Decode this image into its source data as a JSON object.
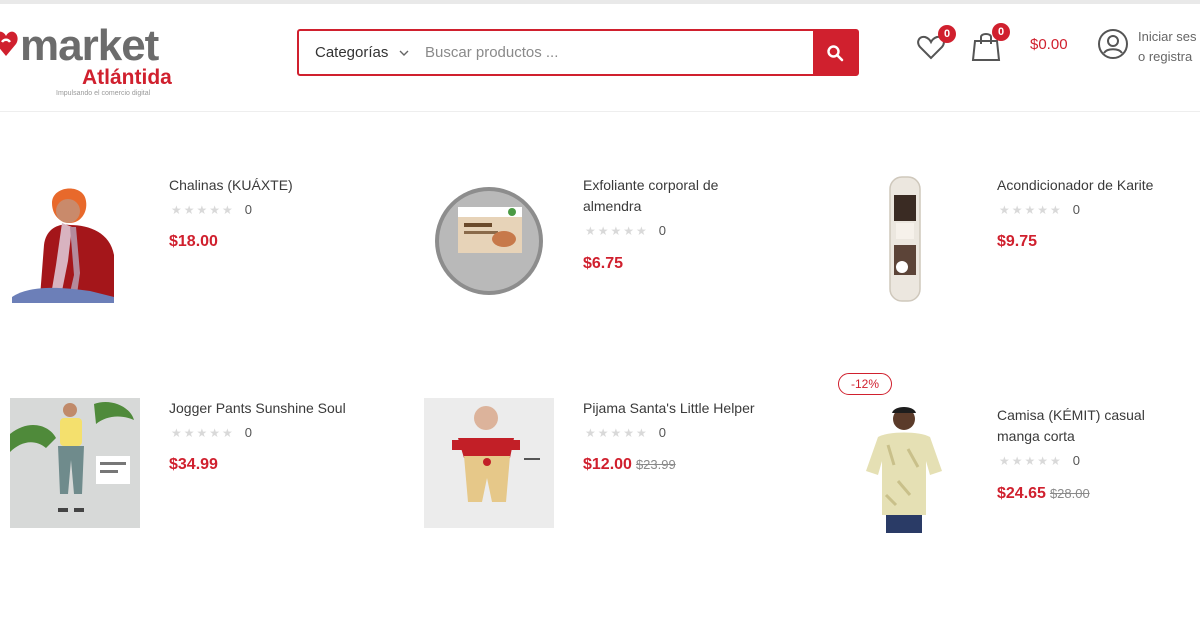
{
  "brand": {
    "name": "market",
    "place": "Atlántida",
    "tagline": "Impulsando el comercio digital",
    "color": "#d0202e"
  },
  "search": {
    "category_label": "Categorías",
    "placeholder": "Buscar productos ..."
  },
  "header": {
    "wishlist_count": "0",
    "cart_count": "0",
    "cart_total": "$0.00",
    "account_line1": "Iniciar ses",
    "account_line2": "o registra"
  },
  "products": [
    {
      "name": "Chalinas (KUÁXTE)",
      "reviews": "0",
      "price": "$18.00",
      "old_price": ""
    },
    {
      "name": "Exfoliante corporal de almendra",
      "reviews": "0",
      "price": "$6.75",
      "old_price": ""
    },
    {
      "name": "Acondicionador de Karite",
      "reviews": "0",
      "price": "$9.75",
      "old_price": ""
    },
    {
      "name": "Jogger Pants Sunshine Soul",
      "reviews": "0",
      "price": "$34.99",
      "old_price": ""
    },
    {
      "name": "Pijama Santa's Little Helper",
      "reviews": "0",
      "price": "$12.00",
      "old_price": "$23.99"
    },
    {
      "name": "Camisa (KÉMIT) casual manga corta",
      "reviews": "0",
      "price": "$24.65",
      "old_price": "$28.00",
      "discount": "-12%"
    }
  ],
  "icons": [
    "logo-heart-icon",
    "chevron-down-icon",
    "search-icon",
    "heart-icon",
    "cart-bag-icon",
    "user-circle-icon",
    "star-icon"
  ]
}
